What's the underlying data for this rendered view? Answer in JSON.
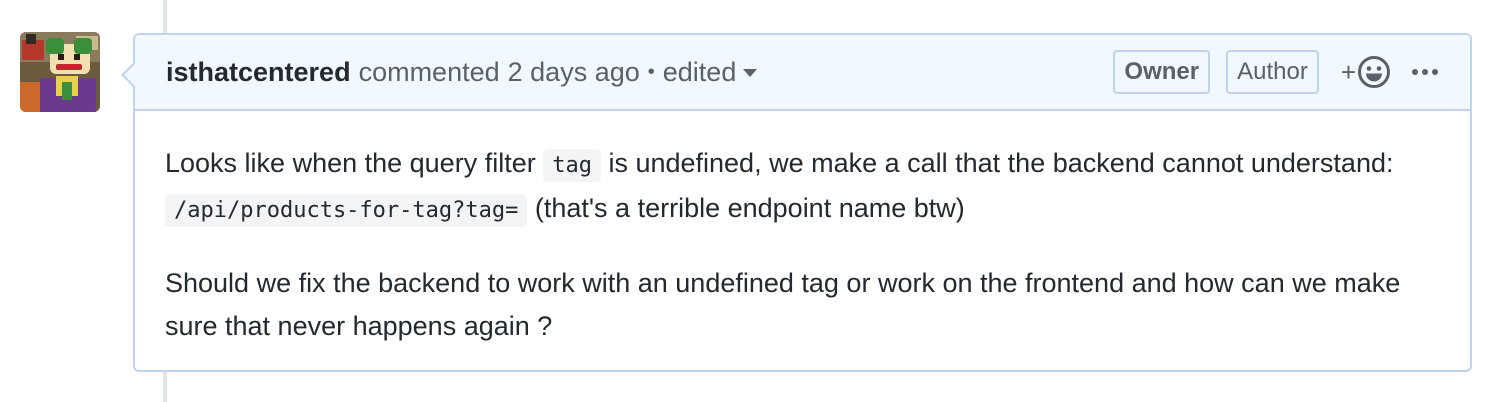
{
  "comment": {
    "author": "isthatcentered",
    "action": "commented",
    "time": "2 days ago",
    "separator": "•",
    "edited_label": "edited",
    "owner_label": "Owner",
    "author_label": "Author",
    "reaction_plus": "+",
    "body": {
      "p1_text1": "Looks like when the query filter ",
      "p1_code1": "tag",
      "p1_text2": " is undefined, we make a call that the backend cannot understand: ",
      "p1_code2": "/api/products-for-tag?tag=",
      "p1_text3": " (that's a terrible endpoint name btw)",
      "p2_text": "Should we fix the backend to work with an undefined tag or work on the frontend and how can we make sure that never happens again ?"
    }
  },
  "icons": {
    "avatar": "avatar-image",
    "reaction": "smiley-icon",
    "more": "kebab-horizontal-icon",
    "edited_dropdown": "caret-down-icon"
  },
  "colors": {
    "header_bg": "#f1f8ff",
    "border": "#c0d3eb",
    "text": "#24292e",
    "muted": "#586069"
  }
}
